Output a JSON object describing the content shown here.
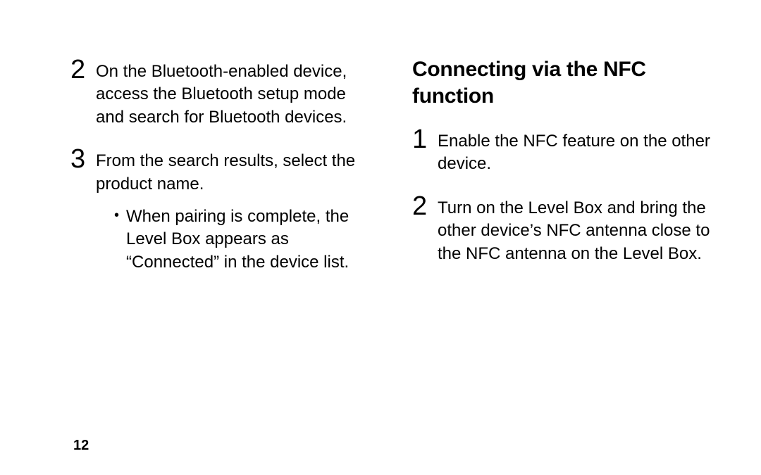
{
  "left": {
    "steps": [
      {
        "num": "2",
        "text": "On the Bluetooth-enabled device, access the Bluetooth setup mode and search for Bluetooth devices."
      },
      {
        "num": "3",
        "text": "From the search results, select the product name."
      }
    ],
    "sub_bullet": "When pairing is complete, the Level Box appears as “Connected” in the device list."
  },
  "right": {
    "heading": "Connecting via the NFC function",
    "steps": [
      {
        "num": "1",
        "text": "Enable the NFC feature on the other device."
      },
      {
        "num": "2",
        "text": "Turn on the Level Box and bring the other device’s NFC antenna close to the NFC antenna on the Level Box."
      }
    ]
  },
  "page_number": "12"
}
